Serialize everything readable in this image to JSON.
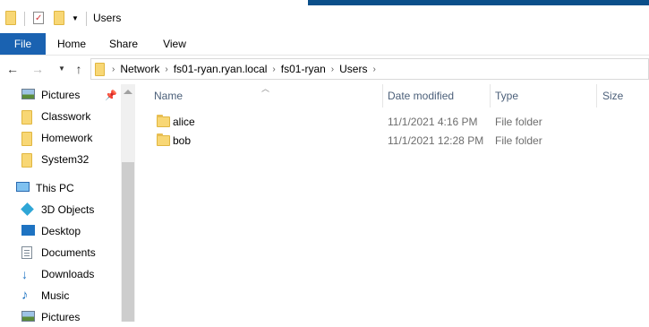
{
  "window": {
    "title": "Users"
  },
  "ribbon": {
    "tabs": [
      "File",
      "Home",
      "Share",
      "View"
    ]
  },
  "address": {
    "crumbs": [
      "Network",
      "fs01-ryan.ryan.local",
      "fs01-ryan",
      "Users"
    ]
  },
  "nav": {
    "items": [
      {
        "label": "Pictures",
        "icon": "pictures-icon"
      },
      {
        "label": "Classwork",
        "icon": "folder-icon"
      },
      {
        "label": "Homework",
        "icon": "folder-icon"
      },
      {
        "label": "System32",
        "icon": "folder-icon"
      },
      {
        "label": "This PC",
        "icon": "monitor-icon"
      },
      {
        "label": "3D Objects",
        "icon": "cube-icon"
      },
      {
        "label": "Desktop",
        "icon": "desktop-icon"
      },
      {
        "label": "Documents",
        "icon": "documents-icon"
      },
      {
        "label": "Downloads",
        "icon": "download-icon"
      },
      {
        "label": "Music",
        "icon": "music-icon"
      },
      {
        "label": "Pictures",
        "icon": "pictures-icon"
      }
    ]
  },
  "columns": {
    "name": "Name",
    "date": "Date modified",
    "type": "Type",
    "size": "Size"
  },
  "files": [
    {
      "name": "alice",
      "date": "11/1/2021 4:16 PM",
      "type": "File folder"
    },
    {
      "name": "bob",
      "date": "11/1/2021 12:28 PM",
      "type": "File folder"
    }
  ]
}
